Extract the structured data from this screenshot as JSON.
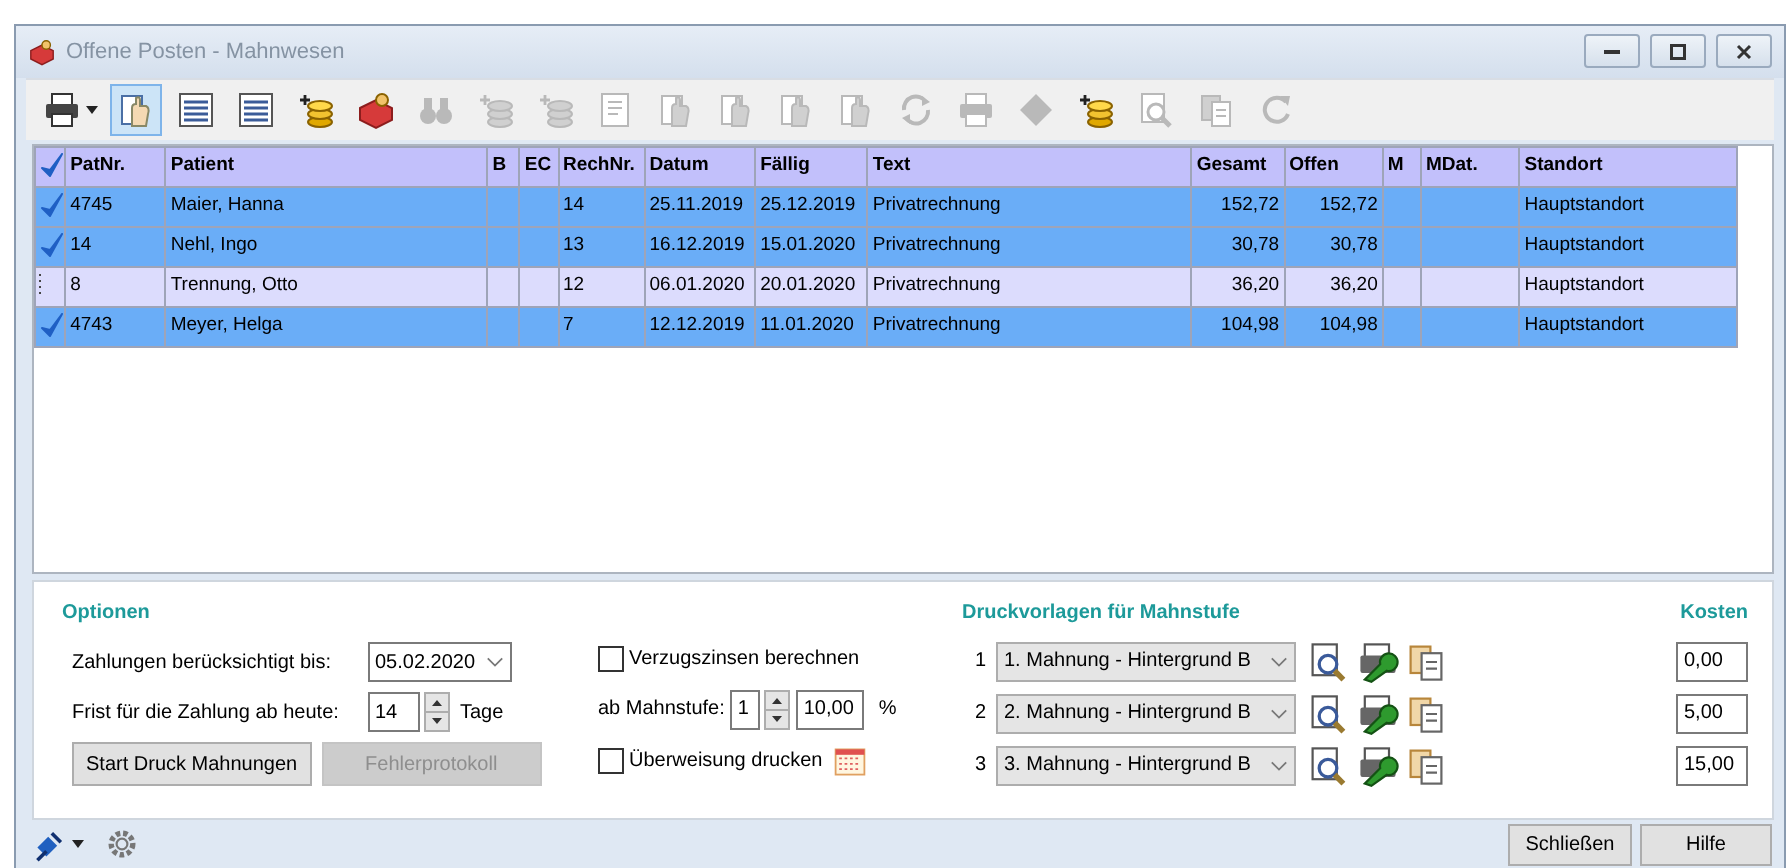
{
  "window": {
    "title": "Offene Posten - Mahnwesen"
  },
  "toolbar": [
    {
      "kind": "printer",
      "disabled": false,
      "selected": false,
      "dropdown": true
    },
    {
      "kind": "hand",
      "disabled": false,
      "selected": true,
      "dropdown": false
    },
    {
      "kind": "list",
      "disabled": false,
      "selected": false,
      "dropdown": false
    },
    {
      "kind": "list",
      "disabled": false,
      "selected": false,
      "dropdown": false
    },
    {
      "kind": "coins",
      "disabled": false,
      "selected": false,
      "dropdown": false
    },
    {
      "kind": "box",
      "disabled": false,
      "selected": false,
      "dropdown": false
    },
    {
      "kind": "binoculars",
      "disabled": true,
      "selected": false,
      "dropdown": false
    },
    {
      "kind": "coins",
      "disabled": true,
      "selected": false,
      "dropdown": false
    },
    {
      "kind": "coins",
      "disabled": true,
      "selected": false,
      "dropdown": false
    },
    {
      "kind": "document",
      "disabled": true,
      "selected": false,
      "dropdown": false
    },
    {
      "kind": "hand",
      "disabled": true,
      "selected": false,
      "dropdown": false
    },
    {
      "kind": "hand",
      "disabled": true,
      "selected": false,
      "dropdown": false
    },
    {
      "kind": "hand",
      "disabled": true,
      "selected": false,
      "dropdown": false
    },
    {
      "kind": "hand",
      "disabled": true,
      "selected": false,
      "dropdown": false
    },
    {
      "kind": "refresh",
      "disabled": true,
      "selected": false,
      "dropdown": false
    },
    {
      "kind": "printer",
      "disabled": true,
      "selected": false,
      "dropdown": false
    },
    {
      "kind": "diamond",
      "disabled": true,
      "selected": false,
      "dropdown": false
    },
    {
      "kind": "coins",
      "disabled": false,
      "selected": false,
      "dropdown": false
    },
    {
      "kind": "preview",
      "disabled": true,
      "selected": false,
      "dropdown": false
    },
    {
      "kind": "copy",
      "disabled": true,
      "selected": false,
      "dropdown": false
    },
    {
      "kind": "redo",
      "disabled": true,
      "selected": false,
      "dropdown": false
    }
  ],
  "table": {
    "all_checked": true,
    "columns": [
      {
        "label": "PatNr.",
        "kind": "text"
      },
      {
        "label": "Patient",
        "kind": "text"
      },
      {
        "label": "B",
        "kind": "text"
      },
      {
        "label": "EC",
        "kind": "text"
      },
      {
        "label": "RechNr.",
        "kind": "text"
      },
      {
        "label": "Datum",
        "kind": "text"
      },
      {
        "label": "Fällig",
        "kind": "text"
      },
      {
        "label": "Text",
        "kind": "text"
      },
      {
        "label": "Gesamt",
        "kind": "amount"
      },
      {
        "label": "Offen",
        "kind": "amount"
      },
      {
        "label": "M",
        "kind": "text"
      },
      {
        "label": "MDat.",
        "kind": "text"
      },
      {
        "label": "Standort",
        "kind": "text"
      }
    ],
    "rows": [
      {
        "checked": true,
        "cells": [
          "4745",
          "Maier, Hanna",
          null,
          null,
          "14",
          "25.11.2019",
          "25.12.2019",
          "Privatrechnung",
          "152,72",
          "152,72",
          null,
          null,
          "Hauptstandort"
        ]
      },
      {
        "checked": true,
        "cells": [
          "14",
          "Nehl, Ingo",
          null,
          null,
          "13",
          "16.12.2019",
          "15.01.2020",
          "Privatrechnung",
          "30,78",
          "30,78",
          null,
          null,
          "Hauptstandort"
        ]
      },
      {
        "checked": false,
        "cells": [
          "8",
          "Trennung, Otto",
          null,
          null,
          "12",
          "06.01.2020",
          "20.01.2020",
          "Privatrechnung",
          "36,20",
          "36,20",
          null,
          null,
          "Hauptstandort"
        ]
      },
      {
        "checked": true,
        "cells": [
          "4743",
          "Meyer, Helga",
          null,
          null,
          "7",
          "12.12.2019",
          "11.01.2020",
          "Privatrechnung",
          "104,98",
          "104,98",
          null,
          null,
          "Hauptstandort"
        ]
      }
    ]
  },
  "options": {
    "title": "Optionen",
    "payments_label": "Zahlungen berücksichtigt bis:",
    "payments_date": "05.02.2020",
    "deadline_label": "Frist für die Zahlung ab heute:",
    "deadline_value": "14",
    "deadline_unit": "Tage",
    "start_button": "Start Druck Mahnungen",
    "error_button": {
      "label": "Fehlerprotokoll",
      "disabled": true
    }
  },
  "interest": {
    "checkbox": {
      "label": "Verzugszinsen berechnen",
      "checked": false
    },
    "from_stage_label": "ab Mahnstufe:",
    "from_stage": "1",
    "rate": "10,00",
    "rate_unit": "%",
    "transfer": {
      "label": "Überweisung drucken",
      "checked": false
    }
  },
  "templates": {
    "title": "Druckvorlagen für Mahnstufe",
    "costs_title": "Kosten",
    "rows": [
      {
        "stage": "1",
        "template": "1. Mahnung - Hintergrund B",
        "cost": "0,00"
      },
      {
        "stage": "2",
        "template": "2. Mahnung - Hintergrund B",
        "cost": "5,00"
      },
      {
        "stage": "3",
        "template": "3. Mahnung - Hintergrund B",
        "cost": "15,00"
      }
    ]
  },
  "footer_buttons": [
    "Schließen",
    "Hilfe"
  ]
}
